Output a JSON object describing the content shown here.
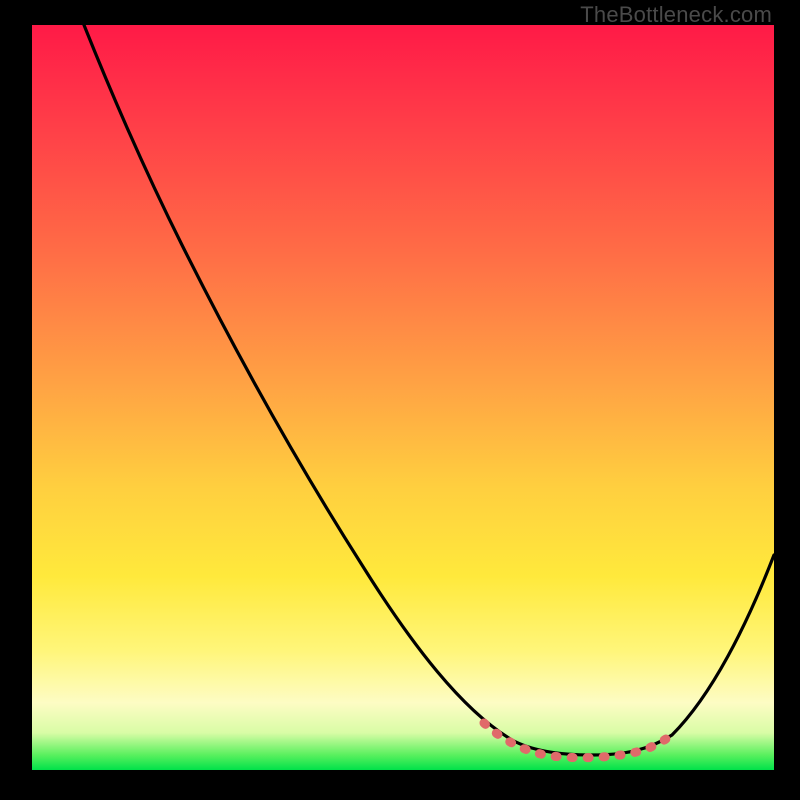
{
  "watermark": "TheBottleneck.com",
  "colors": {
    "gradient_top": "#ff1a47",
    "gradient_mid1": "#ff6b46",
    "gradient_mid2": "#ffe93c",
    "gradient_bottom": "#00e24a",
    "curve": "#000000",
    "valley_highlight": "#e06a6a",
    "frame_bg": "#000000"
  },
  "chart_data": {
    "type": "line",
    "title": "",
    "xlabel": "",
    "ylabel": "",
    "xlim": [
      0,
      100
    ],
    "ylim": [
      0,
      100
    ],
    "grid": false,
    "legend": false,
    "note": "Axes are unlabeled in the image; x/y are normalized 0–100. y=0 is the bottom (green) edge, y=100 is the top (red) edge. The curve starts near the top-left, descends steeply to a flat valley around x≈70–80, then rises toward the right edge. The salmon dotted segment marks the valley floor (~x 61–86, y≈2–5).",
    "series": [
      {
        "name": "bottleneck-curve",
        "x": [
          7,
          12,
          18,
          24,
          30,
          36,
          42,
          48,
          54,
          60,
          66,
          72,
          78,
          84,
          90,
          96,
          100
        ],
        "y": [
          100,
          90,
          80,
          70,
          60,
          50,
          40,
          30,
          22,
          14,
          8,
          4,
          2,
          3,
          8,
          18,
          29
        ]
      }
    ],
    "annotations": [
      {
        "name": "valley-highlight",
        "style": "dotted",
        "color": "#e06a6a",
        "x_range": [
          61,
          86
        ],
        "y_approx": 3
      }
    ]
  }
}
